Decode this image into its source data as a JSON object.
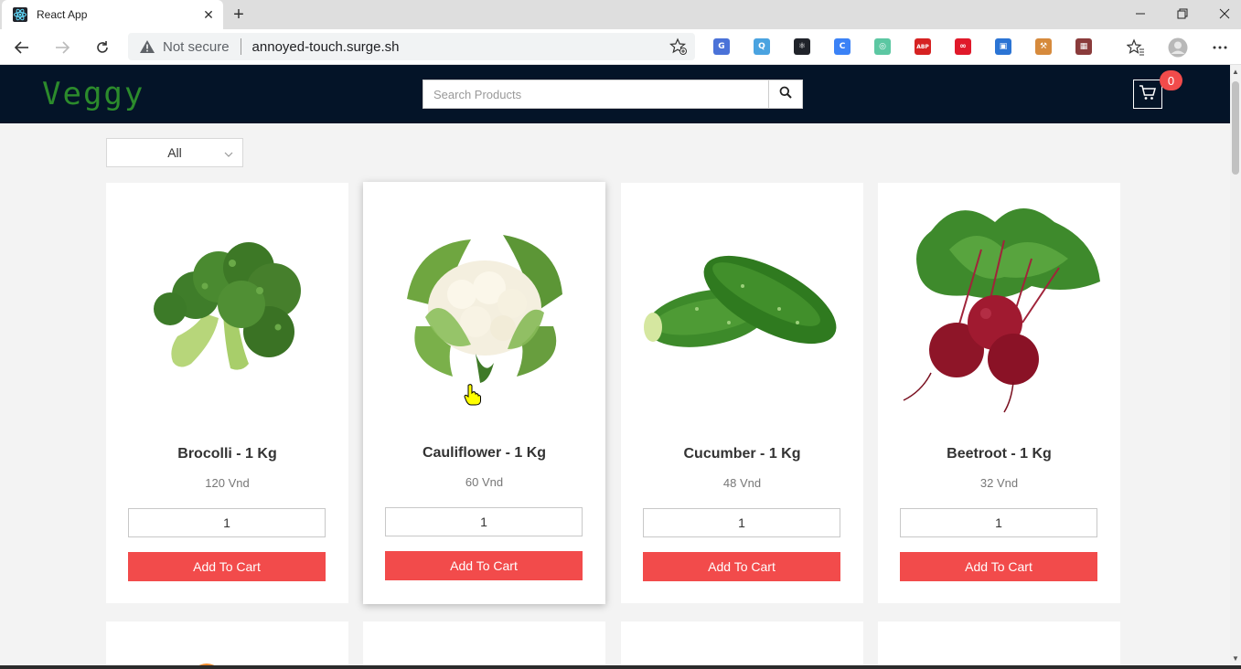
{
  "browser": {
    "tab_title": "React App",
    "address_warning": "Not secure",
    "url": "annoyed-touch.surge.sh"
  },
  "extensions": [
    {
      "name": "translate-ext-icon",
      "color": "#4a72d8",
      "glyph": "G"
    },
    {
      "name": "search-ext-icon",
      "color": "#4aa3e0",
      "glyph": "Q"
    },
    {
      "name": "react-devtools-icon",
      "color": "#20232a",
      "glyph": "⚛"
    },
    {
      "name": "c-ext-icon",
      "color": "#3b82f6",
      "glyph": "C"
    },
    {
      "name": "color-ext-icon",
      "color": "#5cc7a2",
      "glyph": "◎"
    },
    {
      "name": "adblock-plus-icon",
      "color": "#d62222",
      "glyph": "ABP"
    },
    {
      "name": "infinity-ext-icon",
      "color": "#e0192a",
      "glyph": "∞"
    },
    {
      "name": "save-ext-icon",
      "color": "#2b74d4",
      "glyph": "▣"
    },
    {
      "name": "hammer-ext-icon",
      "color": "#d68a3c",
      "glyph": "⚒"
    },
    {
      "name": "grid-ext-icon",
      "color": "#8a3b3b",
      "glyph": "▦"
    }
  ],
  "app": {
    "logo": "Veggy",
    "search_placeholder": "Search Products",
    "cart_count": "0",
    "filter_value": "All"
  },
  "products": [
    {
      "name": "Brocolli - 1 Kg",
      "price": "120 Vnd",
      "qty": "1",
      "button": "Add To Cart"
    },
    {
      "name": "Cauliflower - 1 Kg",
      "price": "60 Vnd",
      "qty": "1",
      "button": "Add To Cart"
    },
    {
      "name": "Cucumber - 1 Kg",
      "price": "48 Vnd",
      "qty": "1",
      "button": "Add To Cart"
    },
    {
      "name": "Beetroot - 1 Kg",
      "price": "32 Vnd",
      "qty": "1",
      "button": "Add To Cart"
    }
  ],
  "colors": {
    "header_bg": "#041428",
    "logo": "#2c8b2c",
    "accent_red": "#f24b4b"
  }
}
